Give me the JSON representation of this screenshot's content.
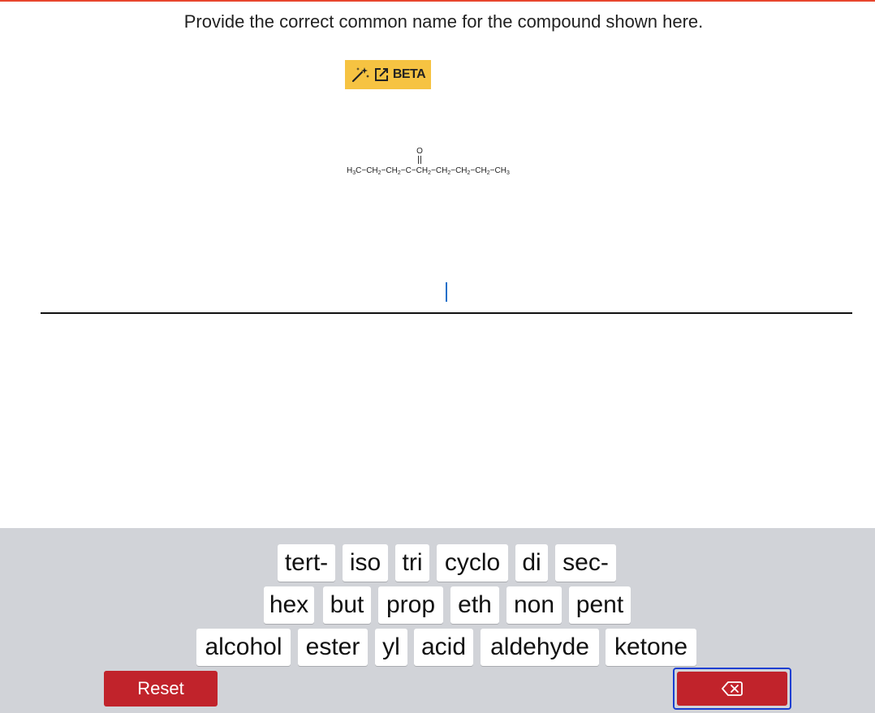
{
  "question": {
    "text": "Provide the correct common name for the compound shown here."
  },
  "beta_badge": {
    "label": "BETA",
    "icons": [
      "magic-wand-icon",
      "external-link-icon"
    ],
    "color": "#f6c342"
  },
  "structure": {
    "oxygen": "O",
    "formula": [
      "H",
      "3",
      "C−CH",
      "2",
      "−CH",
      "2",
      "−C−CH",
      "2",
      "−CH",
      "2",
      "−CH",
      "2",
      "−CH",
      "2",
      "−CH",
      "3"
    ]
  },
  "answer": {
    "value": ""
  },
  "keyboard": {
    "rows": [
      [
        "tert-",
        "iso",
        "tri",
        "cyclo",
        "di",
        "sec-"
      ],
      [
        "hex",
        "but",
        "prop",
        "eth",
        "non",
        "pent"
      ],
      [
        "alcohol",
        "ester",
        "yl",
        "acid",
        "aldehyde",
        "ketone"
      ]
    ],
    "reset_label": "Reset",
    "backspace_icon": "backspace-icon",
    "accent": "#c1232b"
  }
}
